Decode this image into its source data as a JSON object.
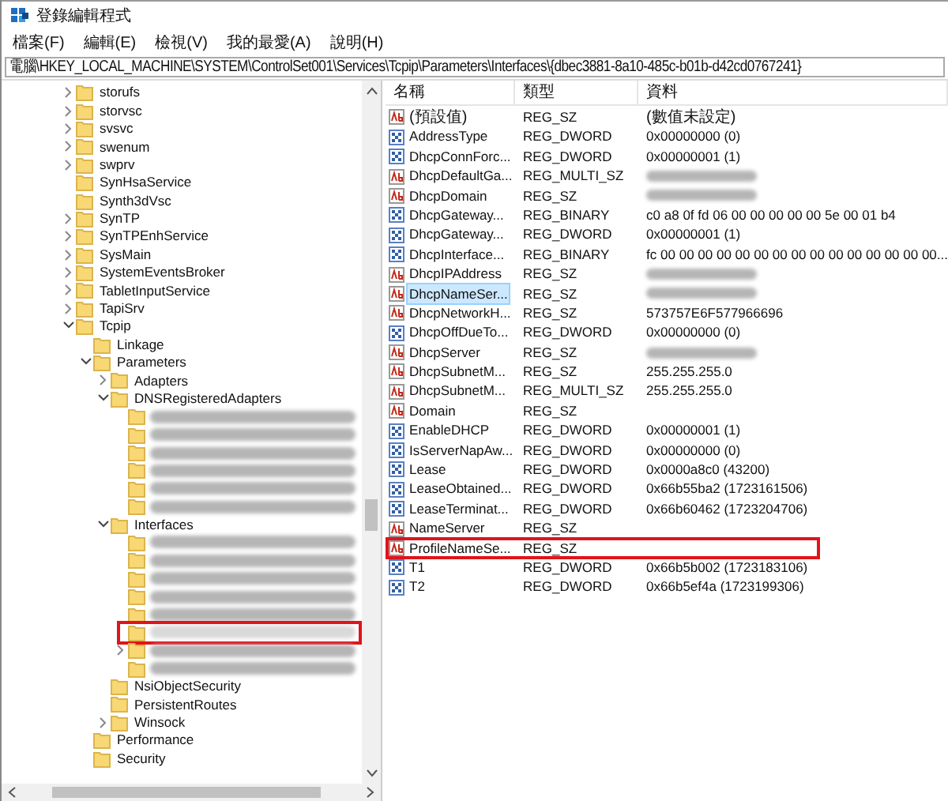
{
  "window": {
    "title": "登錄編輯程式"
  },
  "menu": [
    "檔案(F)",
    "編輯(E)",
    "檢視(V)",
    "我的最愛(A)",
    "說明(H)"
  ],
  "address": "電腦\\HKEY_LOCAL_MACHINE\\SYSTEM\\ControlSet001\\Services\\Tcpip\\Parameters\\Interfaces\\{dbec3881-8a10-485c-b01b-d42cd0767241}",
  "tree": [
    {
      "label": "storufs",
      "expanded": false,
      "selected": false
    },
    {
      "label": "storvsc",
      "expanded": false,
      "selected": false
    },
    {
      "label": "svsvc",
      "expanded": false,
      "selected": false
    },
    {
      "label": "swenum",
      "expanded": false,
      "selected": false
    },
    {
      "label": "swprv",
      "expanded": false,
      "selected": false
    },
    {
      "label": "SynHsaService",
      "selected": false
    },
    {
      "label": "Synth3dVsc",
      "selected": false
    },
    {
      "label": "SynTP",
      "expanded": false,
      "selected": false
    },
    {
      "label": "SynTPEnhService",
      "expanded": false,
      "selected": false
    },
    {
      "label": "SysMain",
      "expanded": false,
      "selected": false
    },
    {
      "label": "SystemEventsBroker",
      "expanded": false,
      "selected": false
    },
    {
      "label": "TabletInputService",
      "expanded": false,
      "selected": false
    },
    {
      "label": "TapiSrv",
      "expanded": false,
      "selected": false
    },
    {
      "label": "Tcpip",
      "expanded": true,
      "selected": false,
      "children": [
        {
          "label": "Linkage",
          "selected": false
        },
        {
          "label": "Parameters",
          "expanded": true,
          "selected": false,
          "children": [
            {
              "label": "Adapters",
              "expanded": false,
              "selected": false
            },
            {
              "label": "DNSRegisteredAdapters",
              "expanded": true,
              "selected": false,
              "children": [
                {
                  "kind": "redacted",
                  "selected": false
                },
                {
                  "kind": "redacted",
                  "selected": false
                },
                {
                  "kind": "redacted",
                  "selected": false
                },
                {
                  "kind": "redacted",
                  "selected": false
                },
                {
                  "kind": "redacted",
                  "selected": false
                },
                {
                  "kind": "redacted",
                  "selected": false
                }
              ]
            },
            {
              "label": "Interfaces",
              "expanded": true,
              "selected": false,
              "children": [
                {
                  "kind": "redacted",
                  "selected": false
                },
                {
                  "kind": "redacted",
                  "selected": false
                },
                {
                  "kind": "redacted",
                  "selected": false
                },
                {
                  "kind": "redacted",
                  "selected": false
                },
                {
                  "kind": "redacted",
                  "selected": false
                },
                {
                  "kind": "redacted",
                  "selected": true,
                  "outlined": true
                },
                {
                  "kind": "redacted",
                  "expanded": false,
                  "selected": false
                },
                {
                  "kind": "redacted",
                  "selected": false
                }
              ]
            },
            {
              "label": "NsiObjectSecurity",
              "selected": false
            },
            {
              "label": "PersistentRoutes",
              "selected": false
            },
            {
              "label": "Winsock",
              "expanded": false,
              "selected": false
            }
          ]
        },
        {
          "label": "Performance",
          "selected": false
        },
        {
          "label": "Security",
          "selected": false
        }
      ]
    }
  ],
  "columns": [
    "名稱",
    "類型",
    "資料"
  ],
  "values": [
    {
      "name": "(預設值)",
      "kind": "string",
      "type": "REG_SZ",
      "data": "(數值未設定)",
      "selected": false
    },
    {
      "name": "AddressType",
      "kind": "binary",
      "type": "REG_DWORD",
      "data": "0x00000000 (0)",
      "selected": false
    },
    {
      "name": "DhcpConnForc...",
      "kind": "binary",
      "type": "REG_DWORD",
      "data": "0x00000001 (1)",
      "selected": false
    },
    {
      "name": "DhcpDefaultGa...",
      "kind": "string",
      "type": "REG_MULTI_SZ",
      "redacted": true,
      "selected": false
    },
    {
      "name": "DhcpDomain",
      "kind": "string",
      "type": "REG_SZ",
      "redacted": true,
      "selected": false
    },
    {
      "name": "DhcpGateway...",
      "kind": "binary",
      "type": "REG_BINARY",
      "data": "c0 a8 0f fd 06 00 00 00 00 00 5e 00 01 b4",
      "selected": false
    },
    {
      "name": "DhcpGateway...",
      "kind": "binary",
      "type": "REG_DWORD",
      "data": "0x00000001 (1)",
      "selected": false
    },
    {
      "name": "DhcpInterface...",
      "kind": "binary",
      "type": "REG_BINARY",
      "data": "fc 00 00 00 00 00 00 00 00 00 00 00 00 00 00 00...",
      "selected": false
    },
    {
      "name": "DhcpIPAddress",
      "kind": "string",
      "type": "REG_SZ",
      "redacted": true,
      "selected": false
    },
    {
      "name": "DhcpNameSer...",
      "kind": "string",
      "type": "REG_SZ",
      "redacted": true,
      "selected": true
    },
    {
      "name": "DhcpNetworkH...",
      "kind": "string",
      "type": "REG_SZ",
      "data": "573757E6F577966696",
      "selected": false
    },
    {
      "name": "DhcpOffDueTo...",
      "kind": "binary",
      "type": "REG_DWORD",
      "data": "0x00000000 (0)",
      "selected": false
    },
    {
      "name": "DhcpServer",
      "kind": "string",
      "type": "REG_SZ",
      "redacted": true,
      "selected": false
    },
    {
      "name": "DhcpSubnetM...",
      "kind": "string",
      "type": "REG_SZ",
      "data": "255.255.255.0",
      "selected": false
    },
    {
      "name": "DhcpSubnetM...",
      "kind": "string",
      "type": "REG_MULTI_SZ",
      "data": "255.255.255.0",
      "selected": false
    },
    {
      "name": "Domain",
      "kind": "string",
      "type": "REG_SZ",
      "selected": false
    },
    {
      "name": "EnableDHCP",
      "kind": "binary",
      "type": "REG_DWORD",
      "data": "0x00000001 (1)",
      "selected": false
    },
    {
      "name": "IsServerNapAw...",
      "kind": "binary",
      "type": "REG_DWORD",
      "data": "0x00000000 (0)",
      "selected": false
    },
    {
      "name": "Lease",
      "kind": "binary",
      "type": "REG_DWORD",
      "data": "0x0000a8c0 (43200)",
      "selected": false
    },
    {
      "name": "LeaseObtained...",
      "kind": "binary",
      "type": "REG_DWORD",
      "data": "0x66b55ba2 (1723161506)",
      "selected": false
    },
    {
      "name": "LeaseTerminat...",
      "kind": "binary",
      "type": "REG_DWORD",
      "data": "0x66b60462 (1723204706)",
      "selected": false
    },
    {
      "name": "NameServer",
      "kind": "string",
      "type": "REG_SZ",
      "selected": false
    },
    {
      "name": "ProfileNameSe...",
      "kind": "string",
      "type": "REG_SZ",
      "selected": false,
      "outlined": true
    },
    {
      "name": "T1",
      "kind": "binary",
      "type": "REG_DWORD",
      "data": "0x66b5b002 (1723183106)",
      "selected": false
    },
    {
      "name": "T2",
      "kind": "binary",
      "type": "REG_DWORD",
      "data": "0x66b5ef4a (1723199306)",
      "selected": false
    }
  ]
}
